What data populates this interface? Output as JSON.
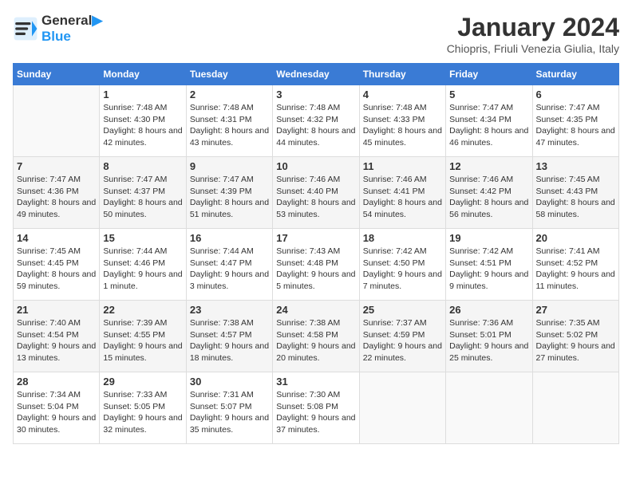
{
  "header": {
    "logo_line1": "General",
    "logo_line2": "Blue",
    "month_title": "January 2024",
    "location": "Chiopris, Friuli Venezia Giulia, Italy"
  },
  "days_of_week": [
    "Sunday",
    "Monday",
    "Tuesday",
    "Wednesday",
    "Thursday",
    "Friday",
    "Saturday"
  ],
  "weeks": [
    [
      {
        "day": "",
        "sunrise": "",
        "sunset": "",
        "daylight": ""
      },
      {
        "day": "1",
        "sunrise": "Sunrise: 7:48 AM",
        "sunset": "Sunset: 4:30 PM",
        "daylight": "Daylight: 8 hours and 42 minutes."
      },
      {
        "day": "2",
        "sunrise": "Sunrise: 7:48 AM",
        "sunset": "Sunset: 4:31 PM",
        "daylight": "Daylight: 8 hours and 43 minutes."
      },
      {
        "day": "3",
        "sunrise": "Sunrise: 7:48 AM",
        "sunset": "Sunset: 4:32 PM",
        "daylight": "Daylight: 8 hours and 44 minutes."
      },
      {
        "day": "4",
        "sunrise": "Sunrise: 7:48 AM",
        "sunset": "Sunset: 4:33 PM",
        "daylight": "Daylight: 8 hours and 45 minutes."
      },
      {
        "day": "5",
        "sunrise": "Sunrise: 7:47 AM",
        "sunset": "Sunset: 4:34 PM",
        "daylight": "Daylight: 8 hours and 46 minutes."
      },
      {
        "day": "6",
        "sunrise": "Sunrise: 7:47 AM",
        "sunset": "Sunset: 4:35 PM",
        "daylight": "Daylight: 8 hours and 47 minutes."
      }
    ],
    [
      {
        "day": "7",
        "sunrise": "Sunrise: 7:47 AM",
        "sunset": "Sunset: 4:36 PM",
        "daylight": "Daylight: 8 hours and 49 minutes."
      },
      {
        "day": "8",
        "sunrise": "Sunrise: 7:47 AM",
        "sunset": "Sunset: 4:37 PM",
        "daylight": "Daylight: 8 hours and 50 minutes."
      },
      {
        "day": "9",
        "sunrise": "Sunrise: 7:47 AM",
        "sunset": "Sunset: 4:39 PM",
        "daylight": "Daylight: 8 hours and 51 minutes."
      },
      {
        "day": "10",
        "sunrise": "Sunrise: 7:46 AM",
        "sunset": "Sunset: 4:40 PM",
        "daylight": "Daylight: 8 hours and 53 minutes."
      },
      {
        "day": "11",
        "sunrise": "Sunrise: 7:46 AM",
        "sunset": "Sunset: 4:41 PM",
        "daylight": "Daylight: 8 hours and 54 minutes."
      },
      {
        "day": "12",
        "sunrise": "Sunrise: 7:46 AM",
        "sunset": "Sunset: 4:42 PM",
        "daylight": "Daylight: 8 hours and 56 minutes."
      },
      {
        "day": "13",
        "sunrise": "Sunrise: 7:45 AM",
        "sunset": "Sunset: 4:43 PM",
        "daylight": "Daylight: 8 hours and 58 minutes."
      }
    ],
    [
      {
        "day": "14",
        "sunrise": "Sunrise: 7:45 AM",
        "sunset": "Sunset: 4:45 PM",
        "daylight": "Daylight: 8 hours and 59 minutes."
      },
      {
        "day": "15",
        "sunrise": "Sunrise: 7:44 AM",
        "sunset": "Sunset: 4:46 PM",
        "daylight": "Daylight: 9 hours and 1 minute."
      },
      {
        "day": "16",
        "sunrise": "Sunrise: 7:44 AM",
        "sunset": "Sunset: 4:47 PM",
        "daylight": "Daylight: 9 hours and 3 minutes."
      },
      {
        "day": "17",
        "sunrise": "Sunrise: 7:43 AM",
        "sunset": "Sunset: 4:48 PM",
        "daylight": "Daylight: 9 hours and 5 minutes."
      },
      {
        "day": "18",
        "sunrise": "Sunrise: 7:42 AM",
        "sunset": "Sunset: 4:50 PM",
        "daylight": "Daylight: 9 hours and 7 minutes."
      },
      {
        "day": "19",
        "sunrise": "Sunrise: 7:42 AM",
        "sunset": "Sunset: 4:51 PM",
        "daylight": "Daylight: 9 hours and 9 minutes."
      },
      {
        "day": "20",
        "sunrise": "Sunrise: 7:41 AM",
        "sunset": "Sunset: 4:52 PM",
        "daylight": "Daylight: 9 hours and 11 minutes."
      }
    ],
    [
      {
        "day": "21",
        "sunrise": "Sunrise: 7:40 AM",
        "sunset": "Sunset: 4:54 PM",
        "daylight": "Daylight: 9 hours and 13 minutes."
      },
      {
        "day": "22",
        "sunrise": "Sunrise: 7:39 AM",
        "sunset": "Sunset: 4:55 PM",
        "daylight": "Daylight: 9 hours and 15 minutes."
      },
      {
        "day": "23",
        "sunrise": "Sunrise: 7:38 AM",
        "sunset": "Sunset: 4:57 PM",
        "daylight": "Daylight: 9 hours and 18 minutes."
      },
      {
        "day": "24",
        "sunrise": "Sunrise: 7:38 AM",
        "sunset": "Sunset: 4:58 PM",
        "daylight": "Daylight: 9 hours and 20 minutes."
      },
      {
        "day": "25",
        "sunrise": "Sunrise: 7:37 AM",
        "sunset": "Sunset: 4:59 PM",
        "daylight": "Daylight: 9 hours and 22 minutes."
      },
      {
        "day": "26",
        "sunrise": "Sunrise: 7:36 AM",
        "sunset": "Sunset: 5:01 PM",
        "daylight": "Daylight: 9 hours and 25 minutes."
      },
      {
        "day": "27",
        "sunrise": "Sunrise: 7:35 AM",
        "sunset": "Sunset: 5:02 PM",
        "daylight": "Daylight: 9 hours and 27 minutes."
      }
    ],
    [
      {
        "day": "28",
        "sunrise": "Sunrise: 7:34 AM",
        "sunset": "Sunset: 5:04 PM",
        "daylight": "Daylight: 9 hours and 30 minutes."
      },
      {
        "day": "29",
        "sunrise": "Sunrise: 7:33 AM",
        "sunset": "Sunset: 5:05 PM",
        "daylight": "Daylight: 9 hours and 32 minutes."
      },
      {
        "day": "30",
        "sunrise": "Sunrise: 7:31 AM",
        "sunset": "Sunset: 5:07 PM",
        "daylight": "Daylight: 9 hours and 35 minutes."
      },
      {
        "day": "31",
        "sunrise": "Sunrise: 7:30 AM",
        "sunset": "Sunset: 5:08 PM",
        "daylight": "Daylight: 9 hours and 37 minutes."
      },
      {
        "day": "",
        "sunrise": "",
        "sunset": "",
        "daylight": ""
      },
      {
        "day": "",
        "sunrise": "",
        "sunset": "",
        "daylight": ""
      },
      {
        "day": "",
        "sunrise": "",
        "sunset": "",
        "daylight": ""
      }
    ]
  ]
}
